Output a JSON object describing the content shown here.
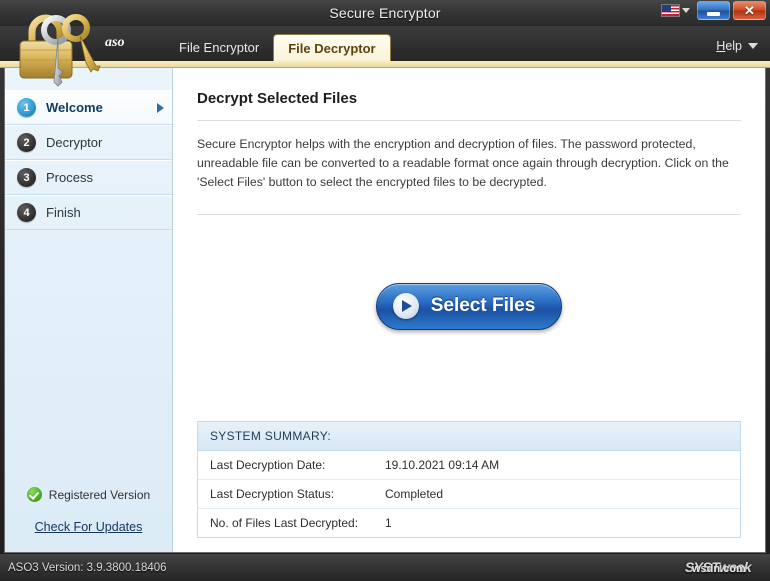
{
  "window": {
    "title": "Secure Encryptor",
    "language_icon": "us-flag-icon",
    "minimize_label": "–",
    "close_label": "✕"
  },
  "tabbar": {
    "brand": "aso",
    "tabs": [
      {
        "label": "File Encryptor",
        "active": false
      },
      {
        "label": "File Decryptor",
        "active": true
      }
    ],
    "help": {
      "prefix": "H",
      "rest": "elp"
    }
  },
  "sidebar": {
    "items": [
      {
        "number": "1",
        "label": "Welcome",
        "active": true
      },
      {
        "number": "2",
        "label": "Decryptor",
        "active": false
      },
      {
        "number": "3",
        "label": "Process",
        "active": false
      },
      {
        "number": "4",
        "label": "Finish",
        "active": false
      }
    ],
    "registered_label": "Registered Version",
    "update_link": "Check For Updates"
  },
  "main": {
    "heading": "Decrypt Selected Files",
    "description": "Secure Encryptor helps with the encryption and decryption of files. The password protected, unreadable file can be converted to a readable format once again through decryption. Click on the 'Select Files' button to select the encrypted files to be decrypted.",
    "select_button": "Select Files",
    "summary": {
      "header": "SYSTEM SUMMARY:",
      "rows": [
        {
          "key": "Last Decryption Date:",
          "value": "19.10.2021 09:14 AM"
        },
        {
          "key": "Last Decryption Status:",
          "value": "Completed"
        },
        {
          "key": "No. of Files Last Decrypted:",
          "value": "1"
        }
      ]
    }
  },
  "statusbar": {
    "version": "ASO3 Version: 3.9.3800.18406",
    "watermark_primary": "SYSTweak",
    "watermark_secondary": "wsdn.com"
  },
  "colors": {
    "accent_blue": "#2b6ec4",
    "tab_active_bg": "#fbf3d8",
    "sidebar_bg": "#e2eff9",
    "summary_header": "#d8e8f5",
    "registered_green": "#45a81e"
  }
}
